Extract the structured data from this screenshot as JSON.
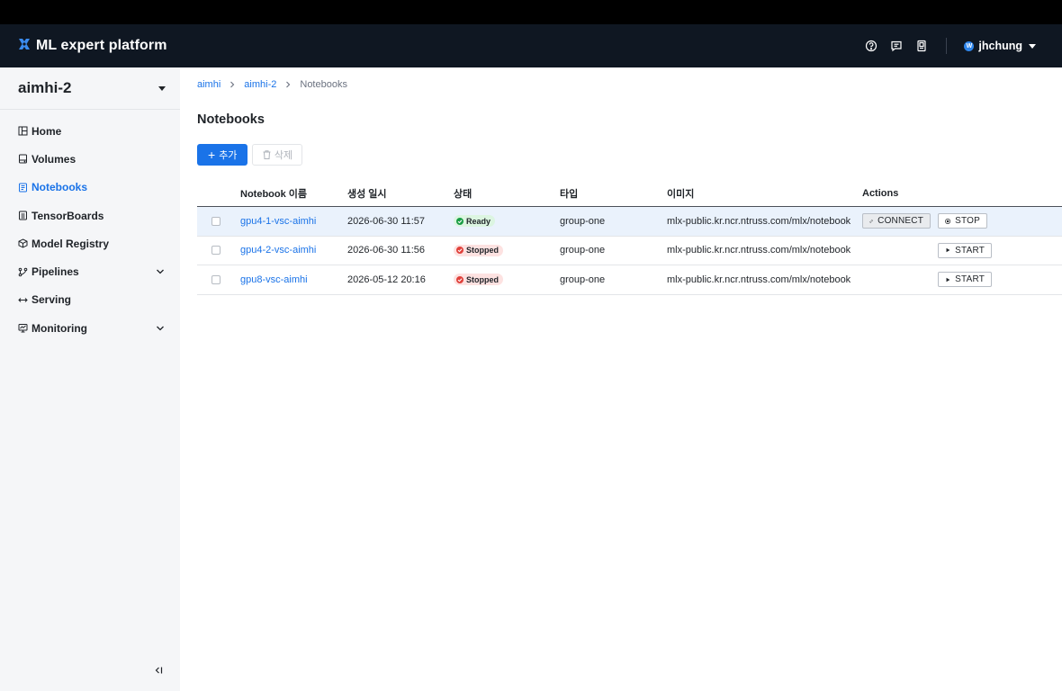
{
  "app": {
    "title": "ML expert platform",
    "user": "jhchung",
    "user_initial": "W",
    "accent_color": "#1a73e8",
    "header_bg": "#0f1722"
  },
  "header": {
    "icons": [
      "help-icon",
      "chat-icon",
      "docs-icon"
    ]
  },
  "sidebar": {
    "project": "aimhi-2",
    "items": [
      {
        "label": "Home",
        "icon": "home-icon",
        "active": false,
        "expandable": false
      },
      {
        "label": "Volumes",
        "icon": "volume-icon",
        "active": false,
        "expandable": false
      },
      {
        "label": "Notebooks",
        "icon": "notebook-icon",
        "active": true,
        "expandable": false
      },
      {
        "label": "TensorBoards",
        "icon": "tensorboard-icon",
        "active": false,
        "expandable": false
      },
      {
        "label": "Model Registry",
        "icon": "model-registry-icon",
        "active": false,
        "expandable": false
      },
      {
        "label": "Pipelines",
        "icon": "pipeline-icon",
        "active": false,
        "expandable": true
      },
      {
        "label": "Serving",
        "icon": "serving-icon",
        "active": false,
        "expandable": false
      },
      {
        "label": "Monitoring",
        "icon": "monitoring-icon",
        "active": false,
        "expandable": true
      }
    ]
  },
  "breadcrumb": [
    "aimhi",
    "aimhi-2",
    "Notebooks"
  ],
  "page": {
    "title": "Notebooks",
    "add_label": "추가",
    "delete_label": "삭제"
  },
  "table": {
    "columns": [
      "Notebook 이름",
      "생성 일시",
      "상태",
      "타입",
      "이미지",
      "Actions"
    ],
    "rows": [
      {
        "name": "gpu4-1-vsc-aimhi",
        "created": "2026-06-30 11:57",
        "status": "Ready",
        "type": "group-one",
        "image": "mlx-public.kr.ncr.ntruss.com/mlx/notebook",
        "actions": [
          "CONNECT",
          "STOP"
        ]
      },
      {
        "name": "gpu4-2-vsc-aimhi",
        "created": "2026-06-30 11:56",
        "status": "Stopped",
        "type": "group-one",
        "image": "mlx-public.kr.ncr.ntruss.com/mlx/notebook",
        "actions": [
          "START"
        ]
      },
      {
        "name": "gpu8-vsc-aimhi",
        "created": "2026-05-12 20:16",
        "status": "Stopped",
        "type": "group-one",
        "image": "mlx-public.kr.ncr.ntruss.com/mlx/notebook",
        "actions": [
          "START"
        ]
      }
    ]
  }
}
